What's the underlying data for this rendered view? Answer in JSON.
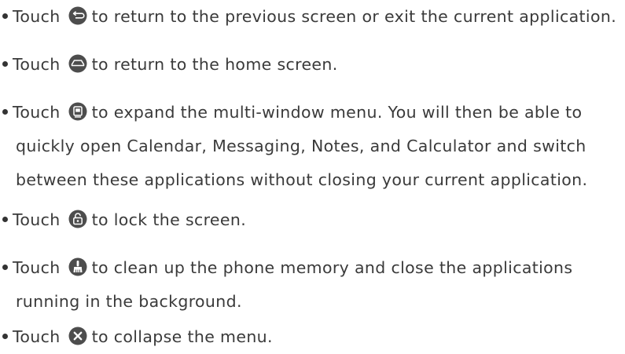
{
  "items": [
    {
      "lead": "Touch",
      "icon": "back-icon",
      "lines": [
        "to return to the previous screen or exit the current application."
      ]
    },
    {
      "lead": "Touch",
      "icon": "home-icon",
      "lines": [
        "to return to the home screen."
      ]
    },
    {
      "lead": "Touch",
      "icon": "multi-window-icon",
      "lines": [
        "to expand the multi-window menu. You will then be able to",
        "quickly open Calendar, Messaging, Notes, and Calculator and switch",
        "between these applications without closing your current application."
      ]
    },
    {
      "lead": "Touch",
      "icon": "lock-icon",
      "lines": [
        "to lock the screen."
      ]
    },
    {
      "lead": "Touch",
      "icon": "clean-brush-icon",
      "lines": [
        "to clean up the phone memory and close the applications",
        "running in the background."
      ]
    },
    {
      "lead": "Touch",
      "icon": "close-icon",
      "lines": [
        "to collapse the menu."
      ]
    }
  ],
  "colors": {
    "text": "#3a3a3a",
    "icon_fill": "#4d4d4d",
    "bullet": "#333333"
  }
}
